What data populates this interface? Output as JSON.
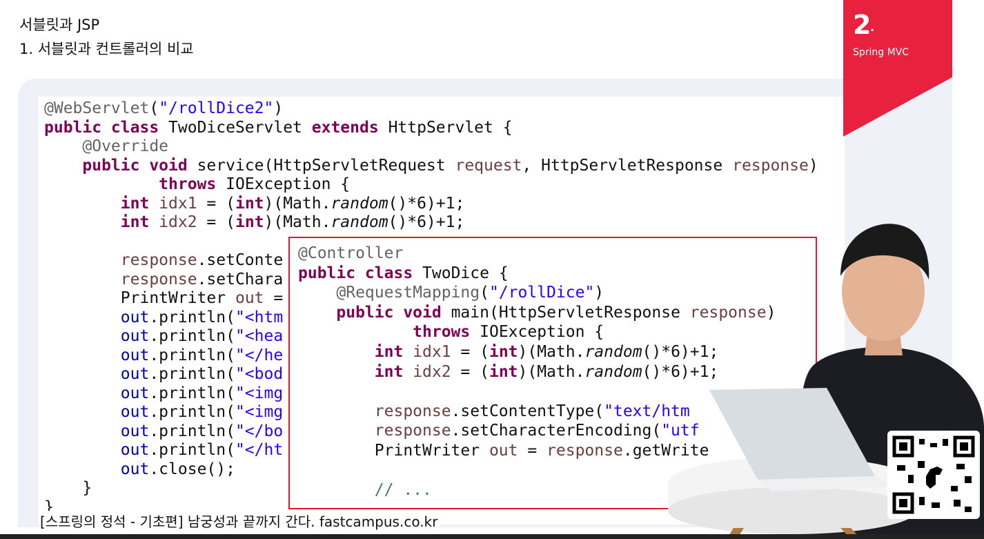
{
  "header": {
    "title": "서블릿과 JSP",
    "subtitle": "1. 서블릿과 컨트롤러의 비교"
  },
  "badge": {
    "number": "2",
    "dot": ".",
    "label": "Spring MVC",
    "color": "#e8213f"
  },
  "code_servlet": {
    "annotation": "@WebServlet",
    "path": "\"/rollDice2\"",
    "class_name": "TwoDiceServlet",
    "super_class": "HttpServlet",
    "override": "@Override",
    "method": "service",
    "req_type": "HttpServletRequest",
    "req_var": "request",
    "res_type": "HttpServletResponse",
    "res_var": "response",
    "exception": "IOException",
    "l_ct": "setConte",
    "l_ce": "setChara",
    "l_pw": "PrintWriter",
    "l_out": "out",
    "p1": "\"<htm",
    "p2": "\"<hea",
    "p3": "\"</he",
    "p4": "\"<bod",
    "p5": "\"<img",
    "p6": "\"<img",
    "p7": "\"</bo",
    "p8": "\"</ht"
  },
  "code_controller": {
    "annotation": "@Controller",
    "class_name": "TwoDice",
    "mapping": "@RequestMapping",
    "path": "\"/rollDice\"",
    "method": "main",
    "res_type": "HttpServletResponse",
    "res_var": "response",
    "exception": "IOException",
    "content_type": "\"text/htm",
    "encoding": "\"utf",
    "writer_call": "getWrite",
    "comment": "// ..."
  },
  "footer": {
    "text": "[스프링의 정석 - 기초편] 남궁성과 끝까지 간다.  fastcampus.co.kr"
  },
  "icons": {
    "qr": "qr-code-icon",
    "presenter": "presenter-photo"
  },
  "colors": {
    "accent": "#e8213f",
    "highlight_border": "#e0182d",
    "panel_bg": "#eef1f8"
  }
}
